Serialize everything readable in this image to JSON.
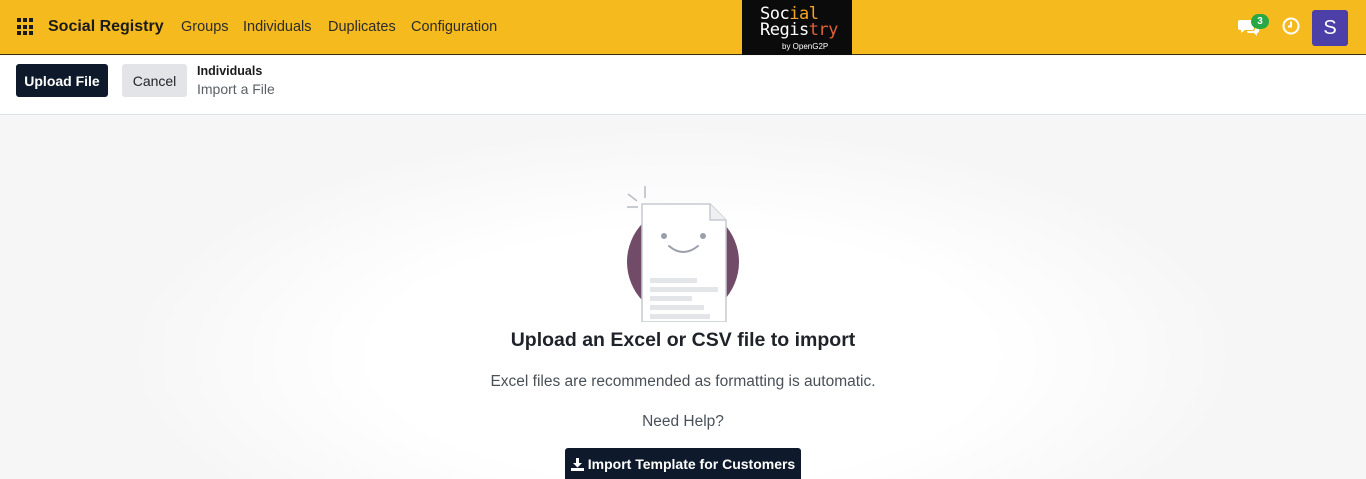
{
  "navbar": {
    "brand": "Social Registry",
    "menu": [
      "Groups",
      "Individuals",
      "Duplicates",
      "Configuration"
    ],
    "logo": {
      "line1_a": "Soc",
      "line1_b": "ial",
      "line2_a": "Regis",
      "line2_b": "try",
      "line3": "by OpenG2P"
    },
    "chat_count": "3",
    "user_initial": "S",
    "colors": {
      "bar": "#f5bb1e",
      "badge": "#28a745",
      "avatar": "#4c3fa8"
    }
  },
  "control": {
    "upload_label": "Upload File",
    "cancel_label": "Cancel",
    "breadcrumb_parent": "Individuals",
    "breadcrumb_current": "Import a File"
  },
  "main": {
    "title": "Upload an Excel or CSV file to import",
    "subtitle": "Excel files are recommended as formatting is automatic.",
    "help": "Need Help?",
    "template_button": "Import Template for Customers"
  }
}
